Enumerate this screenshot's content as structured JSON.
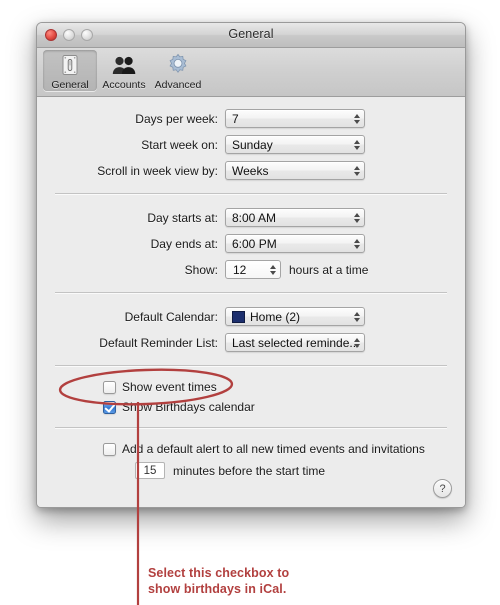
{
  "window": {
    "title": "General",
    "controls": [
      {
        "name": "close",
        "color": "#e24b42"
      },
      {
        "name": "minimize",
        "color": "#dcdcdc"
      },
      {
        "name": "zoom",
        "color": "#dcdcdc"
      }
    ]
  },
  "toolbar": {
    "items": [
      {
        "id": "general",
        "label": "General",
        "icon": "switch-plate-icon",
        "selected": true
      },
      {
        "id": "accounts",
        "label": "Accounts",
        "icon": "people-icon",
        "selected": false
      },
      {
        "id": "advanced",
        "label": "Advanced",
        "icon": "gear-icon",
        "selected": false
      }
    ]
  },
  "form": {
    "group1": [
      {
        "label": "Days per week:",
        "value": "7",
        "width": "w140",
        "swatch": null
      },
      {
        "label": "Start week on:",
        "value": "Sunday",
        "width": "w140",
        "swatch": null
      },
      {
        "label": "Scroll in week view by:",
        "value": "Weeks",
        "width": "w140",
        "swatch": null
      }
    ],
    "group2": [
      {
        "label": "Day starts at:",
        "value": "8:00 AM",
        "width": "w140",
        "swatch": null
      },
      {
        "label": "Day ends at:",
        "value": "6:00 PM",
        "width": "w140",
        "swatch": null
      }
    ],
    "show_row": {
      "label": "Show:",
      "value": "12",
      "suffix": "hours at a time"
    },
    "group3": [
      {
        "label": "Default Calendar:",
        "value": "Home (2)",
        "width": "w140",
        "swatch": "#1c2f6e"
      },
      {
        "label": "Default Reminder List:",
        "value": "Last selected reminde...",
        "width": "w140",
        "swatch": null
      }
    ],
    "checkboxes": [
      {
        "id": "show-event-times",
        "label": "Show event times",
        "checked": false
      },
      {
        "id": "show-birthdays",
        "label": "Show Birthdays calendar",
        "checked": true
      }
    ],
    "default_alert": {
      "label": "Add a default alert to all new timed events and invitations",
      "checked": false,
      "minutes": "15",
      "suffix": "minutes before the start time"
    },
    "help_label": "?"
  },
  "annotation": {
    "caption_line1": "Select this checkbox to",
    "caption_line2": "show birthdays in iCal.",
    "color": "#b2403f"
  }
}
